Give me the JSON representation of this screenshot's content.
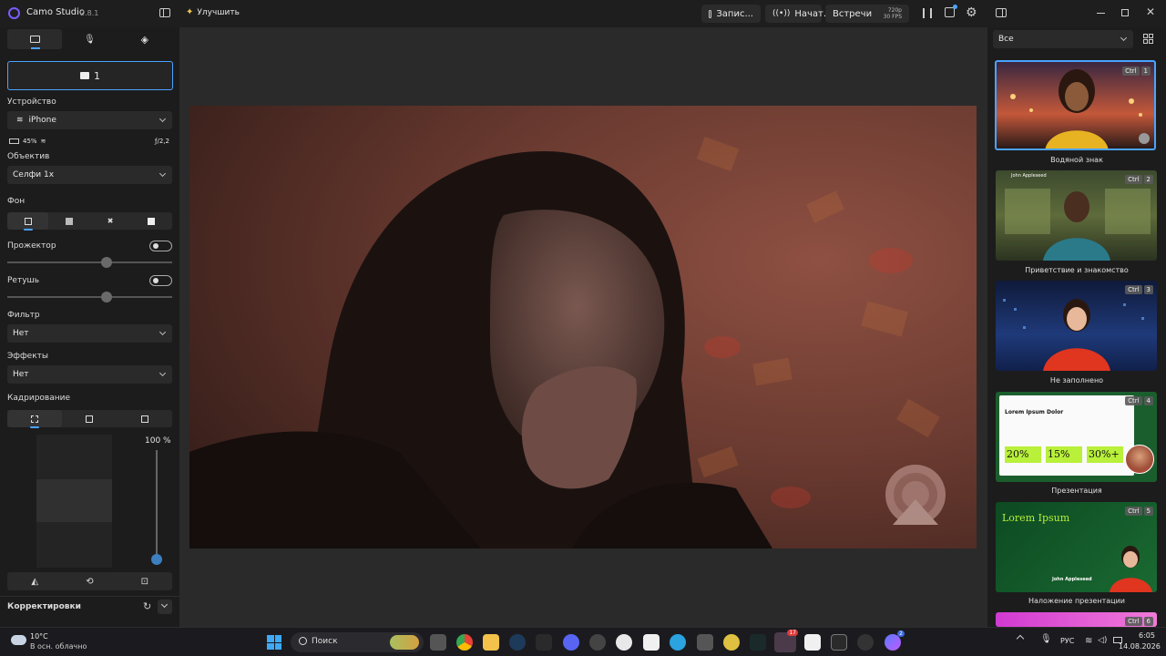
{
  "titlebar": {
    "app_name": "Camo Studio",
    "version": "2.8.1",
    "enhance_label": "Улучшить",
    "record_label": "Запис...",
    "stream_label": "Начат...",
    "meetings_label": "Встречи",
    "resolution": "720p",
    "fps": "30 FPS"
  },
  "left_panel": {
    "camera_number": "1",
    "device_label": "Устройство",
    "device_value": "iPhone",
    "battery": "45%",
    "aperture": "ƒ/2,2",
    "lens_label": "Объектив",
    "lens_value": "Селфи 1x",
    "background_label": "Фон",
    "spotlight_label": "Прожектор",
    "retouch_label": "Ретушь",
    "filter_label": "Фильтр",
    "filter_value": "Нет",
    "effects_label": "Эффекты",
    "effects_value": "Нет",
    "crop_label": "Кадрирование",
    "zoom_value": "100 %",
    "adjustments_label": "Корректировки"
  },
  "right_panel": {
    "filter_value": "Все",
    "scenes": [
      {
        "name": "Водяной знак",
        "key": "Ctrl",
        "num": "1"
      },
      {
        "name": "Приветствие и знакомство",
        "key": "Ctrl",
        "num": "2"
      },
      {
        "name": "Не заполнено",
        "key": "Ctrl",
        "num": "3"
      },
      {
        "name": "Презентация",
        "key": "Ctrl",
        "num": "4"
      },
      {
        "name": "Наложение презентации",
        "key": "Ctrl",
        "num": "5"
      },
      {
        "name": "",
        "key": "Ctrl",
        "num": "6"
      }
    ],
    "scene2_person": "John Appleseed",
    "scene4_title": "Lorem Ipsum Dolor",
    "scene4_stats": [
      "20%",
      "15%",
      "30%+"
    ],
    "scene5_title": "Lorem Ipsum",
    "scene5_person": "John Appleseed"
  },
  "taskbar": {
    "weather_temp": "10°C",
    "weather_desc": "В осн. облачно",
    "search_placeholder": "Поиск",
    "language": "РУС",
    "time": "6:05",
    "date": "14.08.2026",
    "notif_badge_1": "17",
    "notif_badge_2": "2"
  },
  "colors": {
    "accent": "#4aa3ff",
    "logo": "#7b5cff",
    "slide_green": "#b8f03a"
  }
}
